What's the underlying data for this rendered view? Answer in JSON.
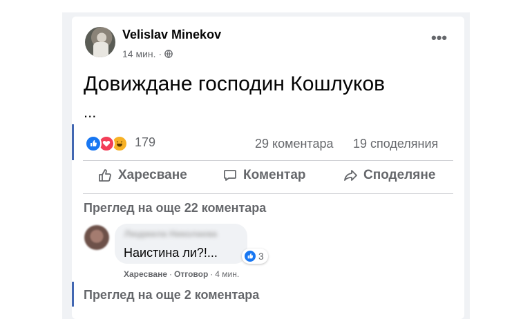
{
  "post": {
    "author": "Velislav Minekov",
    "time": "14 мин.",
    "separator": "·",
    "text": "Довиждане господин Кошлуков",
    "ellipsis": "...",
    "reactions_count": "179",
    "comments_count": "29 коментара",
    "shares_count": "19 споделяния"
  },
  "actions": {
    "like_label": "Харесване",
    "comment_label": "Коментар",
    "share_label": "Споделяне"
  },
  "comments": {
    "view_more_top": "Преглед на още 22 коментара",
    "item": {
      "author": "Людмила Николаева",
      "text": "Наистина ли?!...",
      "like_count": "3",
      "like_action": "Харесване",
      "reply_action": "Отговор",
      "dot": "·",
      "time": "4 мин."
    },
    "view_more_bottom": "Преглед на още 2 коментара"
  },
  "colors": {
    "accent": "#4267b2",
    "like_blue": "#1877f2",
    "love_red": "#f33e58",
    "haha_yellow": "#f7b125",
    "secondary_text": "#65676b"
  },
  "icons": [
    "globe-icon",
    "more-options-icon",
    "like-reaction-icon",
    "love-reaction-icon",
    "haha-reaction-icon",
    "thumbs-up-icon",
    "comment-icon",
    "share-icon"
  ]
}
